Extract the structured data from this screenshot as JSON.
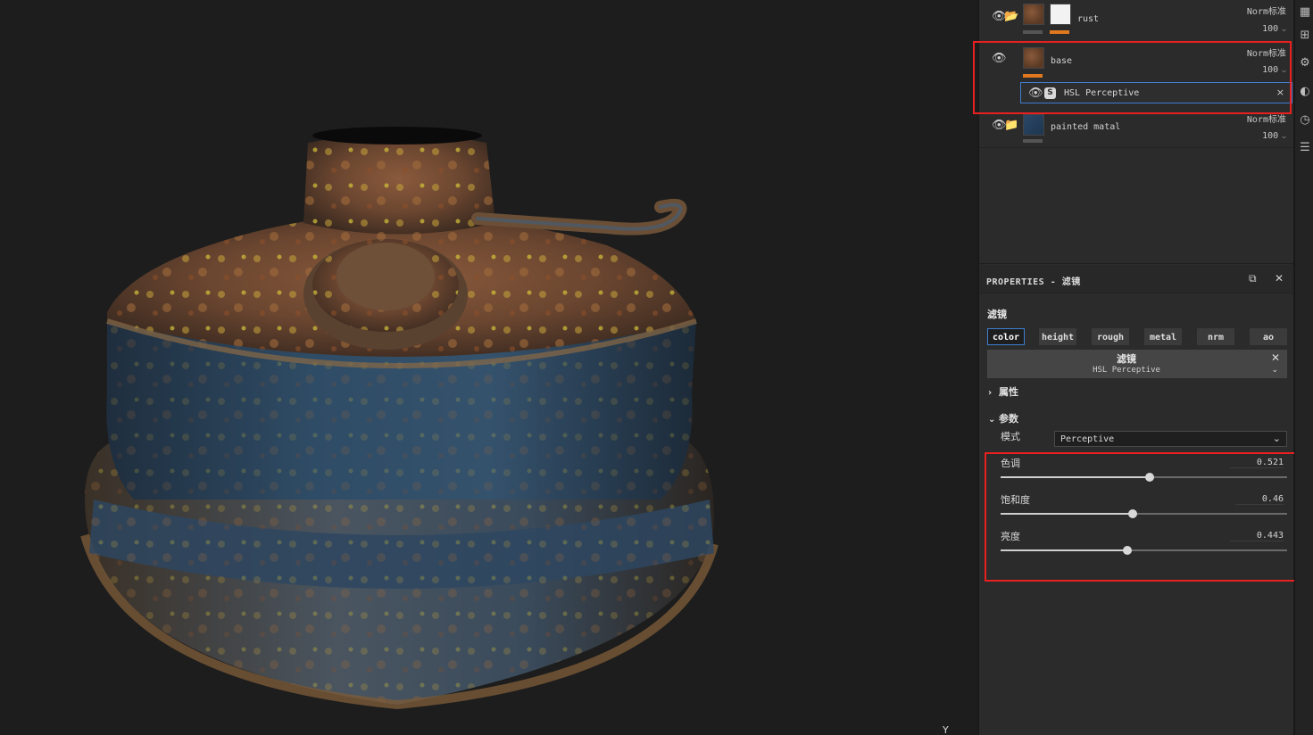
{
  "viewport": {
    "axis_label": "Y",
    "model": "rusty-painted-metal-canister"
  },
  "layers": [
    {
      "name": "rust",
      "blend": "Norm标准",
      "opacity": "100",
      "color": "#e07820"
    },
    {
      "name": "base",
      "blend": "Norm标准",
      "opacity": "100",
      "color": "#e07820",
      "filter": {
        "name": "HSL Perceptive",
        "badge": "S",
        "close": "×"
      }
    },
    {
      "name": "painted matal",
      "blend": "Norm标准",
      "opacity": "100",
      "color": "#555555"
    }
  ],
  "properties": {
    "header": "PROPERTIES - 滤镜",
    "section_title": "滤镜",
    "channels": [
      "color",
      "height",
      "rough",
      "metal",
      "nrm",
      "ao"
    ],
    "active_channel": "color",
    "filter_box": {
      "title": "滤镜",
      "subtitle": "HSL Perceptive"
    },
    "attributes_label": "属性",
    "params_label": "参数",
    "mode_label": "模式",
    "mode_value": "Perceptive",
    "sliders": [
      {
        "label": "色调",
        "value": "0.521",
        "fraction": 0.521
      },
      {
        "label": "饱和度",
        "value": "0.46",
        "fraction": 0.46
      },
      {
        "label": "亮度",
        "value": "0.443",
        "fraction": 0.443
      }
    ]
  },
  "toolbar_icons": [
    "layers-icon",
    "grid-icon",
    "settings-icon",
    "palette-icon",
    "history-icon",
    "document-icon"
  ],
  "colors": {
    "highlight": "#e82020",
    "selection": "#3f7fd1",
    "accent": "#e07820"
  }
}
